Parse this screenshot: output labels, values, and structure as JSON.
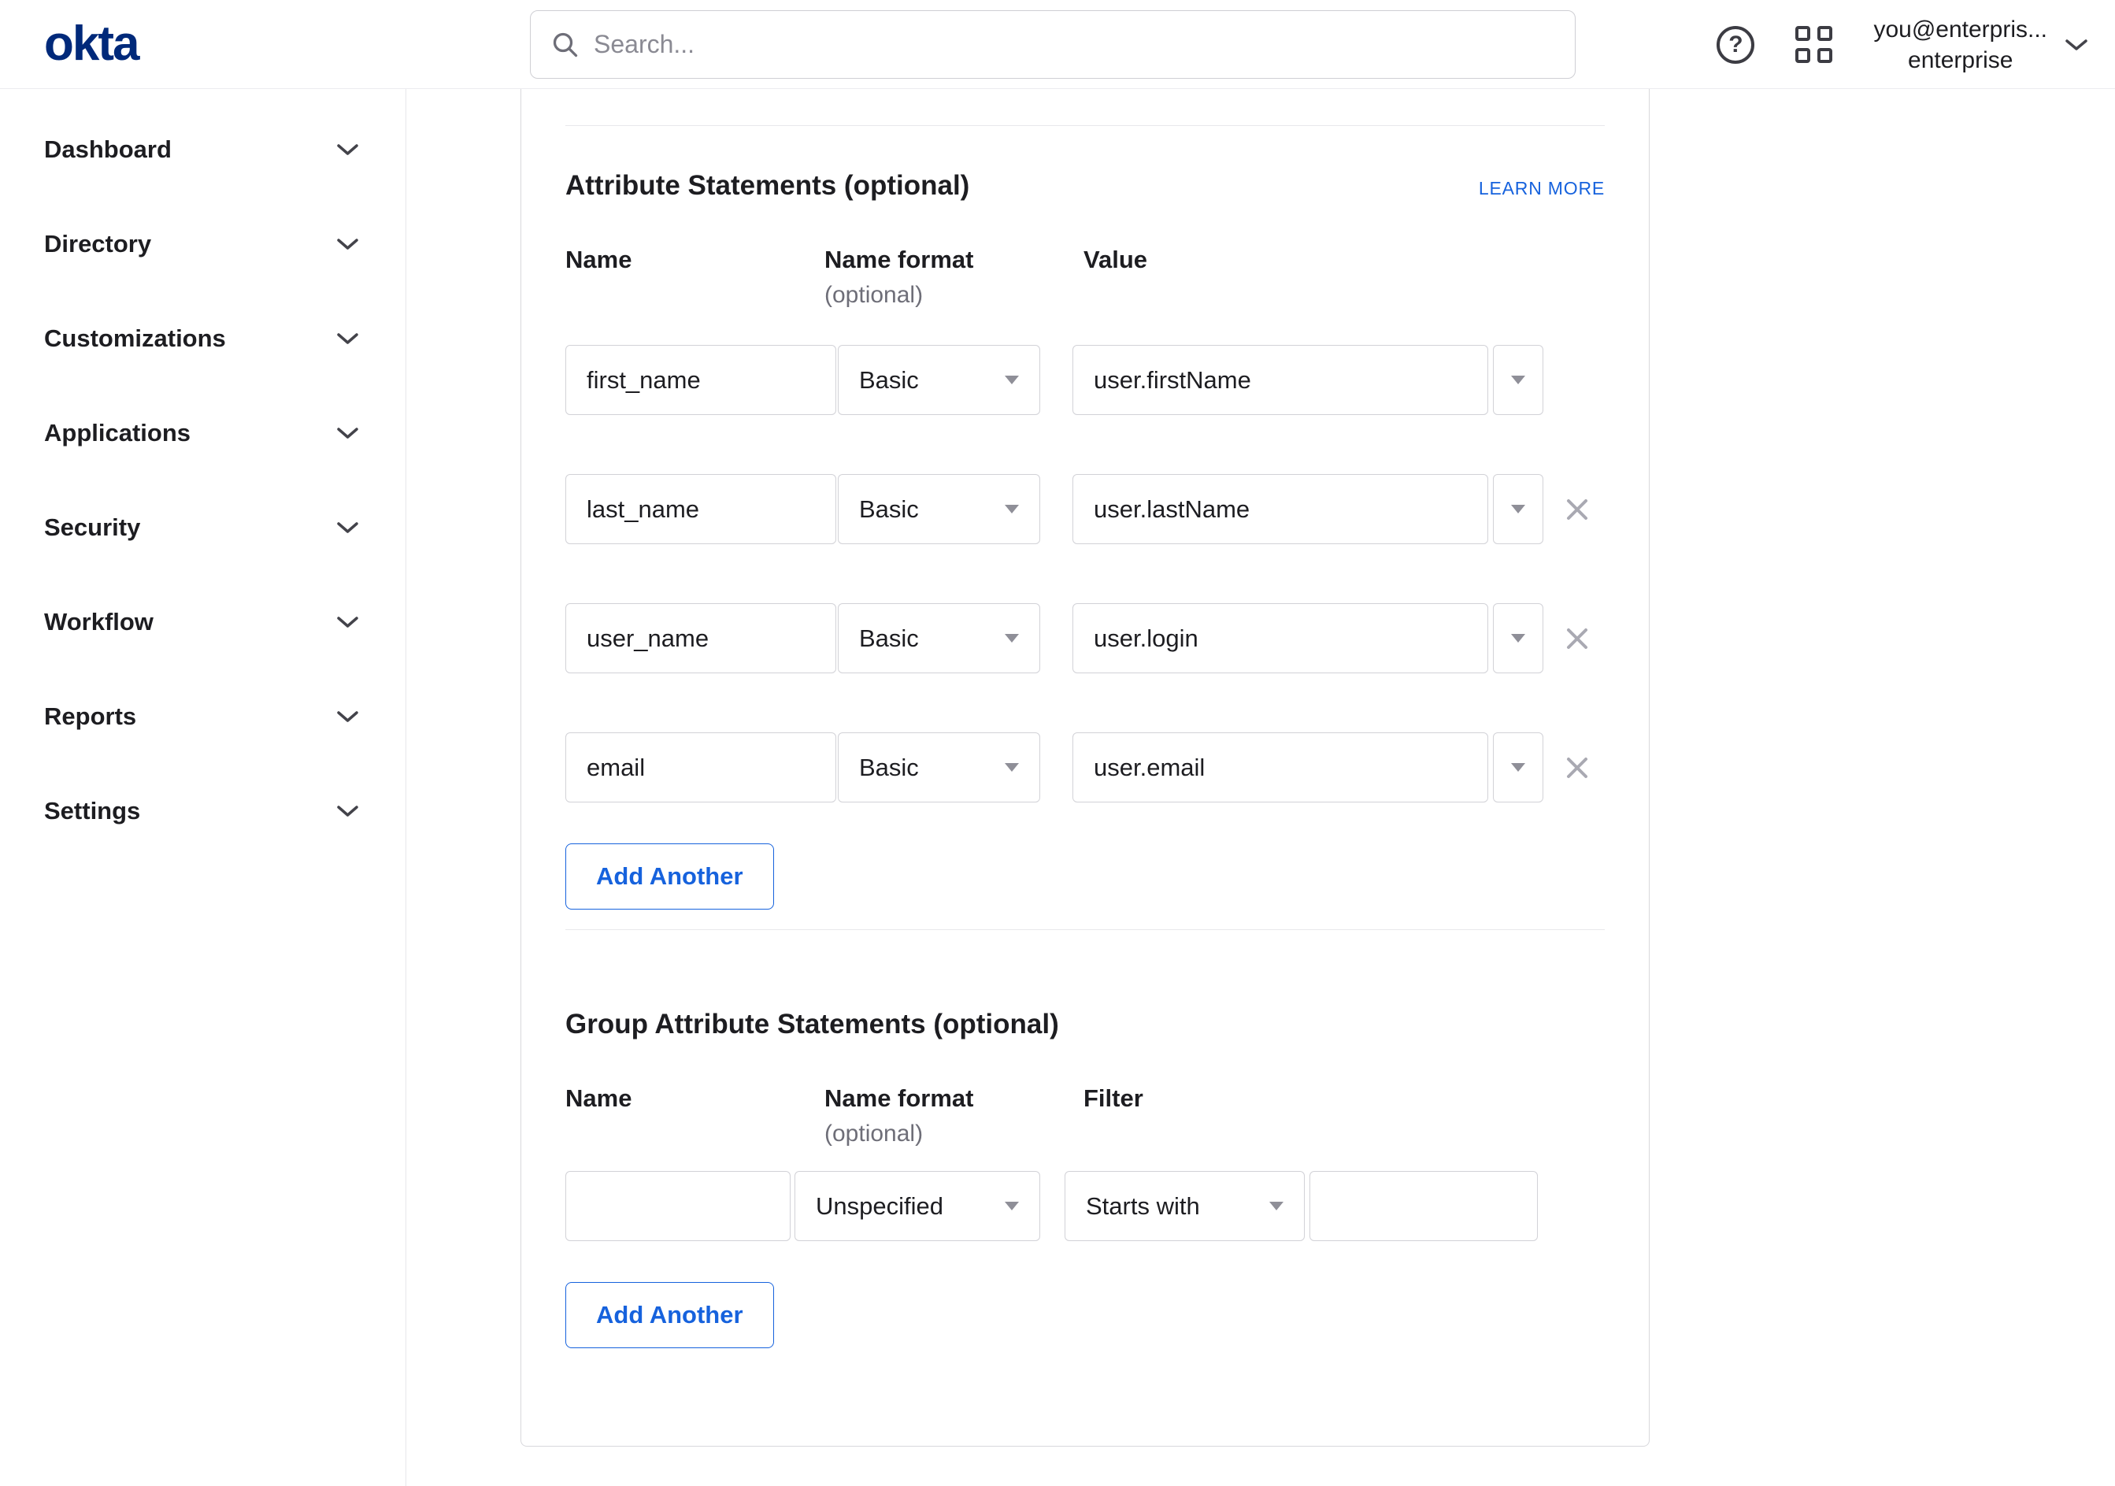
{
  "colors": {
    "accent_blue": "#1662dd",
    "logo_blue": "#00297a"
  },
  "topbar": {
    "logo": "okta",
    "search_placeholder": "Search...",
    "account": {
      "line1": "you@enterpris...",
      "line2": "enterprise"
    }
  },
  "sidebar": {
    "items": [
      {
        "label": "Dashboard"
      },
      {
        "label": "Directory"
      },
      {
        "label": "Customizations"
      },
      {
        "label": "Applications"
      },
      {
        "label": "Security"
      },
      {
        "label": "Workflow"
      },
      {
        "label": "Reports"
      },
      {
        "label": "Settings"
      }
    ]
  },
  "attribute_statements": {
    "title": "Attribute Statements (optional)",
    "learn_more_label": "LEARN MORE",
    "headers": {
      "name": "Name",
      "name_format": "Name format",
      "name_format_note": "(optional)",
      "value": "Value"
    },
    "rows": [
      {
        "name": "first_name",
        "format": "Basic",
        "value": "user.firstName"
      },
      {
        "name": "last_name",
        "format": "Basic",
        "value": "user.lastName"
      },
      {
        "name": "user_name",
        "format": "Basic",
        "value": "user.login"
      },
      {
        "name": "email",
        "format": "Basic",
        "value": "user.email"
      }
    ],
    "add_button_label": "Add Another"
  },
  "group_attribute_statements": {
    "title": "Group Attribute Statements (optional)",
    "headers": {
      "name": "Name",
      "name_format": "Name format",
      "name_format_note": "(optional)",
      "filter": "Filter"
    },
    "rows": [
      {
        "name": "",
        "format": "Unspecified",
        "filter_type": "Starts with",
        "filter_value": ""
      }
    ],
    "add_button_label": "Add Another"
  }
}
